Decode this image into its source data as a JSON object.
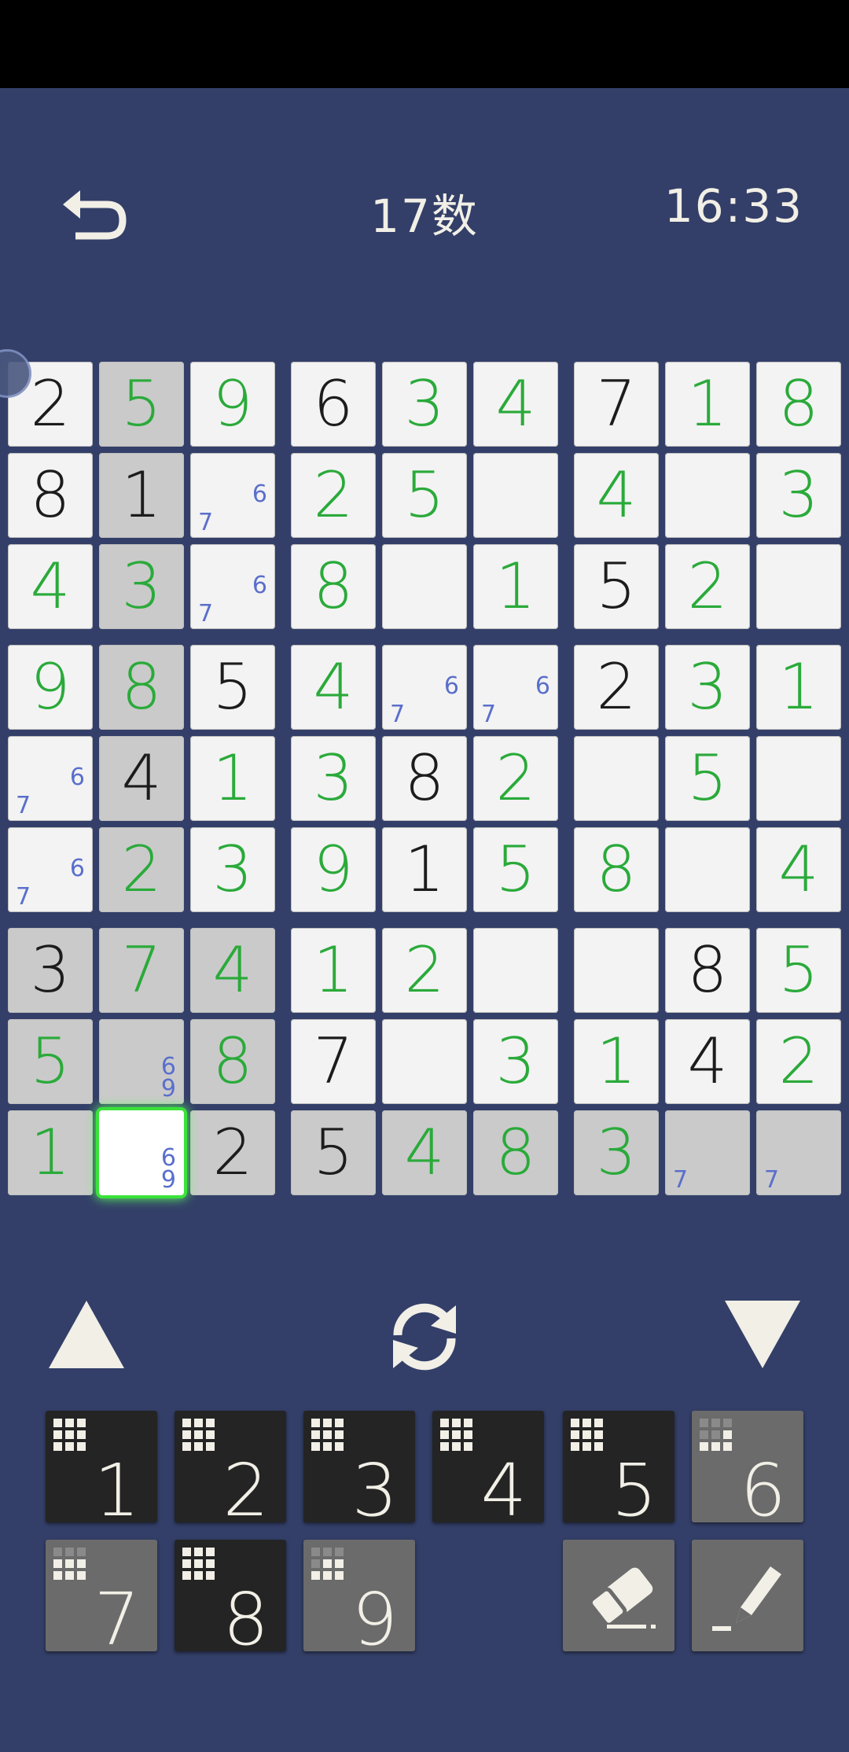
{
  "header": {
    "title": "17数",
    "timer": "16:33"
  },
  "grid": {
    "rows": [
      [
        "2",
        "5",
        "9",
        "6",
        "3",
        "4",
        "7",
        "1",
        "8"
      ],
      [
        "8",
        "1",
        "",
        "2",
        "5",
        "",
        "4",
        "",
        "3"
      ],
      [
        "4",
        "3",
        "",
        "8",
        "",
        "1",
        "5",
        "2",
        ""
      ],
      [
        "9",
        "8",
        "5",
        "4",
        "",
        "",
        "2",
        "3",
        "1"
      ],
      [
        "",
        "4",
        "1",
        "3",
        "8",
        "2",
        "",
        "5",
        ""
      ],
      [
        "",
        "2",
        "3",
        "9",
        "1",
        "5",
        "8",
        "",
        "4"
      ],
      [
        "3",
        "7",
        "4",
        "1",
        "2",
        "",
        "",
        "8",
        "5"
      ],
      [
        "5",
        "",
        "8",
        "7",
        "",
        "3",
        "1",
        "4",
        "2"
      ],
      [
        "1",
        "",
        "2",
        "5",
        "4",
        "8",
        "3",
        "",
        ""
      ]
    ],
    "kind": [
      "GEEGEEGEE",
      "GGNEENEEE",
      "EENENEGEN",
      "EEGEGGGEE",
      "NGEEGEEEN",
      "NEEEGEENE",
      "GEEEENEGE",
      "ENEGNEEGE",
      "ENGGEEENN"
    ],
    "highlight": [
      "010000000",
      "010000000",
      "010000000",
      "010000000",
      "010000000",
      "010000000",
      "111000000",
      "111000000",
      "111111111"
    ],
    "selected": [
      8,
      1
    ],
    "notes": [
      {
        "r": 1,
        "c": 2,
        "tl": "6",
        "bl": "7"
      },
      {
        "r": 2,
        "c": 2,
        "tl": "6",
        "bl": "7"
      },
      {
        "r": 3,
        "c": 4,
        "tl": "6",
        "bl": "7"
      },
      {
        "r": 3,
        "c": 5,
        "tl": "6",
        "bl": "7"
      },
      {
        "r": 4,
        "c": 0,
        "tl": "6",
        "bl": "7"
      },
      {
        "r": 5,
        "c": 0,
        "tl": "6",
        "bl": "7"
      },
      {
        "r": 7,
        "c": 1,
        "br1": "6",
        "br2": "9"
      },
      {
        "r": 8,
        "c": 1,
        "br1": "6",
        "br2": "9"
      },
      {
        "r": 8,
        "c": 7,
        "bl": "7"
      },
      {
        "r": 8,
        "c": 8,
        "bl": "7"
      }
    ]
  },
  "keypad": [
    {
      "label": "1",
      "dim": false,
      "remaining": 0
    },
    {
      "label": "2",
      "dim": false,
      "remaining": 0
    },
    {
      "label": "3",
      "dim": false,
      "remaining": 0
    },
    {
      "label": "4",
      "dim": false,
      "remaining": 0
    },
    {
      "label": "5",
      "dim": false,
      "remaining": 0
    },
    {
      "label": "6",
      "dim": true,
      "remaining": 5
    },
    {
      "label": "7",
      "dim": true,
      "remaining": 3
    },
    {
      "label": "8",
      "dim": false,
      "remaining": 0
    },
    {
      "label": "9",
      "dim": true,
      "remaining": 4
    }
  ],
  "icons": {
    "back": "undo-arrow-icon",
    "prev": "triangle-up-icon",
    "refresh": "refresh-icon",
    "next": "triangle-down-icon",
    "eraser": "eraser-icon",
    "pencil": "pencil-icon"
  },
  "colors": {
    "background": "#333f68",
    "entered": "#2aaa3a",
    "given": "#1c1c1c",
    "note": "#5a6fcc",
    "selected_glow": "#3ae23a"
  }
}
